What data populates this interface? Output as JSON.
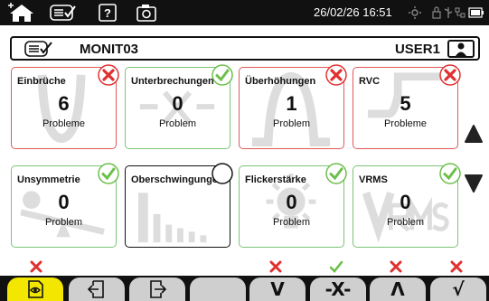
{
  "statusbar": {
    "datetime": "26/02/26 16:51"
  },
  "header": {
    "title": "MONIT03",
    "user": "USER1"
  },
  "cards": [
    {
      "name": "Einbrüche",
      "count": "6",
      "label": "Probleme",
      "status": "fail"
    },
    {
      "name": "Unterbrechungen",
      "count": "0",
      "label": "Problem",
      "status": "ok"
    },
    {
      "name": "Überhöhungen",
      "count": "1",
      "label": "Problem",
      "status": "fail"
    },
    {
      "name": "RVC",
      "count": "5",
      "label": "Probleme",
      "status": "fail"
    },
    {
      "name": "Unsymmetrie",
      "count": "0",
      "label": "Problem",
      "status": "ok"
    },
    {
      "name": "Oberschwingungen",
      "count": "",
      "label": "",
      "status": "none"
    },
    {
      "name": "Flickerstärke",
      "count": "0",
      "label": "Problem",
      "status": "ok"
    },
    {
      "name": "VRMS",
      "count": "0",
      "label": "Problem",
      "status": "ok"
    }
  ],
  "tabs": [
    {
      "id": "overview",
      "glyph": "",
      "status": "fail",
      "active": true
    },
    {
      "id": "back",
      "glyph": "",
      "status": "none",
      "active": false
    },
    {
      "id": "forward",
      "glyph": "",
      "status": "none",
      "active": false
    },
    {
      "id": "empty",
      "glyph": "",
      "status": "none",
      "active": false
    },
    {
      "id": "dips",
      "glyph": "V",
      "status": "fail",
      "active": false
    },
    {
      "id": "interruptions",
      "glyph": "-X-",
      "status": "ok",
      "active": false
    },
    {
      "id": "swells",
      "glyph": "Λ",
      "status": "fail",
      "active": false
    },
    {
      "id": "rvc",
      "glyph": "√",
      "status": "fail",
      "active": false
    }
  ],
  "colors": {
    "fail": "#e03030",
    "ok": "#6cbf4a",
    "active_tab": "#f3e600",
    "inactive_tab": "#cfcfcf"
  }
}
